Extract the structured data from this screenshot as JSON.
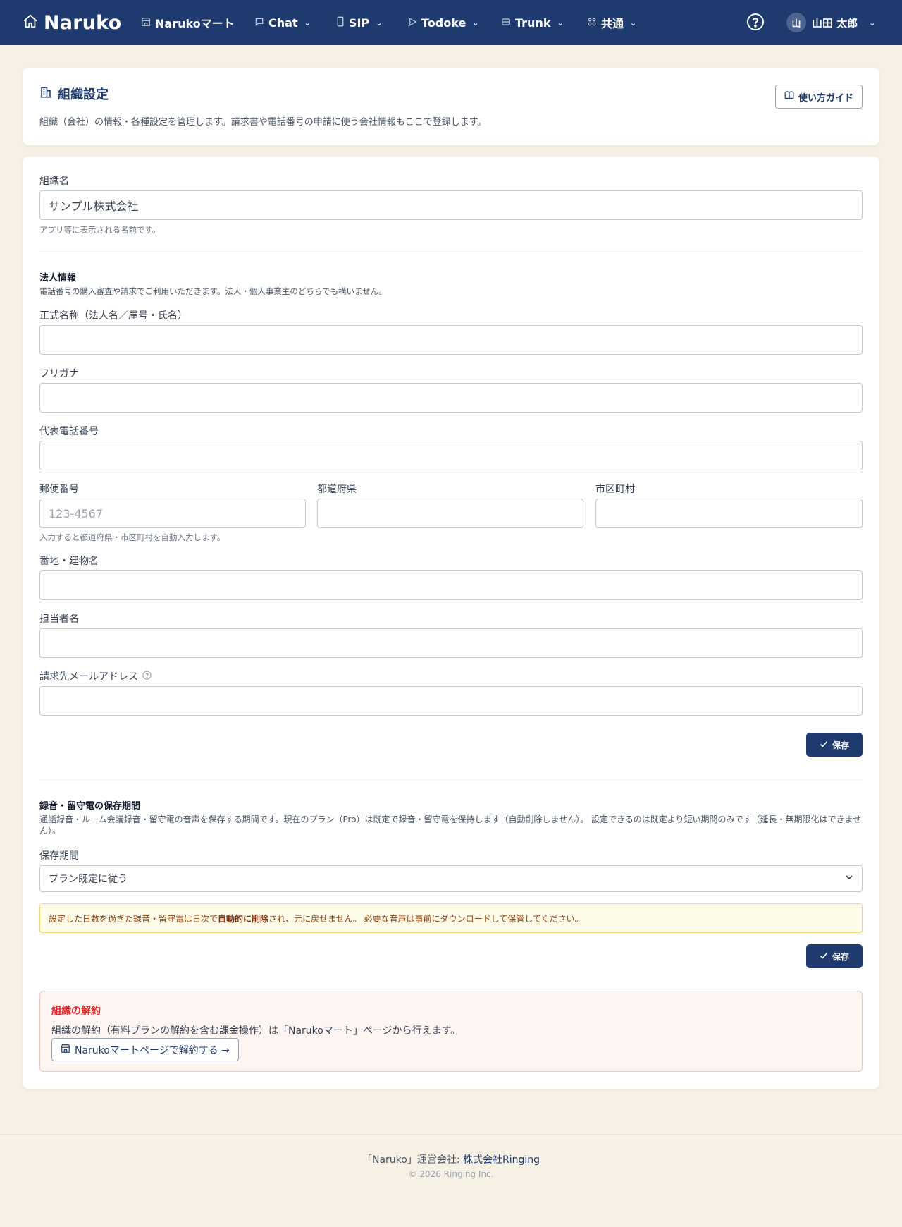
{
  "nav": {
    "brand": "Naruko",
    "items": [
      {
        "label": "Narukoマート",
        "icon": "store-icon",
        "has_dropdown": false
      },
      {
        "label": "Chat",
        "icon": "chat-bubble-icon",
        "has_dropdown": true
      },
      {
        "label": "SIP",
        "icon": "phone-icon",
        "has_dropdown": true
      },
      {
        "label": "Todoke",
        "icon": "send-icon",
        "has_dropdown": true
      },
      {
        "label": "Trunk",
        "icon": "database-icon",
        "has_dropdown": true
      },
      {
        "label": "共通",
        "icon": "grid-icon",
        "has_dropdown": true
      }
    ],
    "user_initial": "山",
    "user_name": "山田 太郎"
  },
  "header": {
    "title": "組織設定",
    "description": "組織（会社）の情報・各種設定を管理します。請求書や電話番号の申請に使う会社情報もここで登録します。",
    "guide_button": "使い方ガイド"
  },
  "org": {
    "name_label": "組織名",
    "name_value": "サンプル株式会社",
    "name_hint": "アプリ等に表示される名前です。"
  },
  "corp": {
    "title": "法人情報",
    "description": "電話番号の購入審査や請求でご利用いただきます。法人・個人事業主のどちらでも構いません。",
    "official_name_label": "正式名称（法人名／屋号・氏名）",
    "official_name_value": "",
    "furigana_label": "フリガナ",
    "furigana_value": "",
    "phone_label": "代表電話番号",
    "phone_value": "",
    "postal_label": "郵便番号",
    "postal_placeholder": "123-4567",
    "prefecture_label": "都道府県",
    "prefecture_value": "",
    "city_label": "市区町村",
    "city_value": "",
    "postal_hint": "入力すると都道府県・市区町村を自動入力します。",
    "address_label": "番地・建物名",
    "address_value": "",
    "contact_label": "担当者名",
    "contact_value": "",
    "billing_email_label": "請求先メールアドレス",
    "billing_email_value": "",
    "save_label": "保存"
  },
  "retention": {
    "title": "録音・留守電の保存期間",
    "description": "通話録音・ルーム会議録音・留守電の音声を保存する期間です。現在のプラン（Pro）は既定で録音・留守電を保持します（自動削除しません）。 設定できるのは既定より短い期間のみです（延長・無期限化はできません）。",
    "period_label": "保存期間",
    "period_selected": "プラン既定に従う",
    "warning_pre": "設定した日数を過ぎた録音・留守電は日次で",
    "warning_bold": "自動的に削除",
    "warning_post": "され、元に戻せません。 必要な音声は事前にダウンロードして保管してください。",
    "save_label": "保存"
  },
  "cancel": {
    "title": "組織の解約",
    "description": "組織の解約（有料プランの解約を含む課金操作）は「Narukoマート」ページから行えます。",
    "button": "Narukoマートページで解約する →"
  },
  "footer": {
    "operator_prefix": "「Naruko」運営会社: ",
    "company": "株式会社Ringing",
    "copyright": "© 2026 Ringing Inc."
  },
  "colors": {
    "navbar": "#1e3a6e",
    "background": "#f6f0e5",
    "primary": "#1e3a6e",
    "danger": "#dc2626",
    "warning_bg": "#fefbe8"
  }
}
